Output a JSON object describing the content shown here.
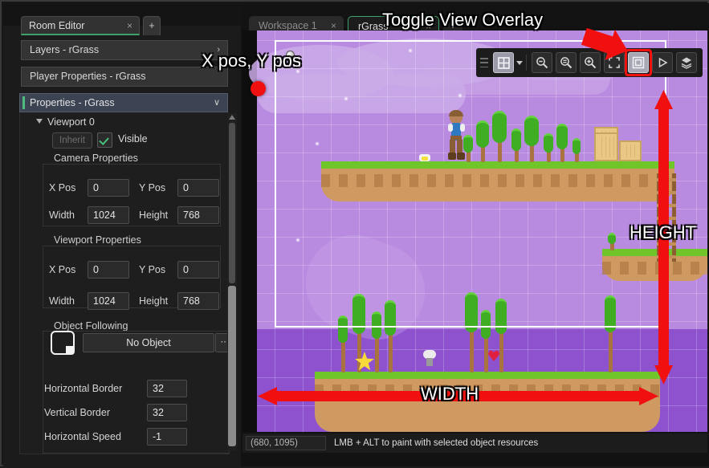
{
  "left_panel": {
    "tabs": [
      {
        "label": "Room Editor",
        "close": "×",
        "active": true
      },
      {
        "label": "+",
        "active": false
      }
    ],
    "bars": [
      {
        "label": "Layers - rGrass",
        "chevron": "›"
      },
      {
        "label": "Player Properties - rGrass",
        "chevron": ""
      }
    ],
    "properties_header": {
      "title": "Properties - rGrass",
      "chevron": "∨"
    },
    "tree": {
      "viewport_label": "Viewport 0"
    },
    "inherit_button": "Inherit",
    "visible_label": "Visible",
    "camera_properties": {
      "title": "Camera Properties",
      "fields": [
        {
          "label": "X Pos",
          "value": "0"
        },
        {
          "label": "Y Pos",
          "value": "0"
        },
        {
          "label": "Width",
          "value": "1024"
        },
        {
          "label": "Height",
          "value": "768"
        }
      ]
    },
    "viewport_properties": {
      "title": "Viewport Properties",
      "fields": [
        {
          "label": "X Pos",
          "value": "0"
        },
        {
          "label": "Y Pos",
          "value": "0"
        },
        {
          "label": "Width",
          "value": "1024"
        },
        {
          "label": "Height",
          "value": "768"
        }
      ]
    },
    "object_following": {
      "title": "Object Following",
      "object_value": "No Object",
      "dots_label": "⋯",
      "fields": [
        {
          "label": "Horizontal Border",
          "value": "32"
        },
        {
          "label": "Vertical Border",
          "value": "32"
        },
        {
          "label": "Horizontal Speed",
          "value": "-1"
        }
      ]
    }
  },
  "editor": {
    "tabs": [
      {
        "label": "Workspace 1",
        "close": "×",
        "active": false
      },
      {
        "label": "rGrass",
        "close": "×",
        "active": true
      },
      {
        "label": "+",
        "active": false
      }
    ],
    "toolbar": {
      "buttons": [
        {
          "name": "grid-icon",
          "title": "Grid"
        },
        {
          "name": "chevron-down-icon",
          "title": "Grid options"
        },
        {
          "name": "zoom-out-icon",
          "title": "Zoom Out"
        },
        {
          "name": "zoom-reset-icon",
          "title": "Zoom 100%"
        },
        {
          "name": "zoom-in-icon",
          "title": "Zoom In"
        },
        {
          "name": "fit-to-screen-icon",
          "title": "Fit to Screen"
        },
        {
          "name": "toggle-view-overlay-icon",
          "title": "Toggle View Overlay"
        },
        {
          "name": "play-icon",
          "title": "Run"
        },
        {
          "name": "layers-icon",
          "title": "Layers"
        }
      ]
    },
    "statusbar": {
      "coordinates": "(680, 1095)",
      "hint": "LMB + ALT to paint with selected object resources"
    }
  },
  "annotations": [
    {
      "id": "toggle-view-overlay",
      "text": "Toggle View Overlay"
    },
    {
      "id": "x-pos-y-pos",
      "text": "X pos, Y pos"
    },
    {
      "id": "height",
      "text": "HEIGHT"
    },
    {
      "id": "width",
      "text": "WIDTH"
    }
  ],
  "colors": {
    "accent_green": "#3ea06a",
    "annotation_red": "#f01010",
    "panel_bg": "#1e1e1e",
    "selected_header": "#3c4454",
    "sky": "#8e52cf",
    "grass": "#6fc52a",
    "dirt": "#cf9a62"
  }
}
